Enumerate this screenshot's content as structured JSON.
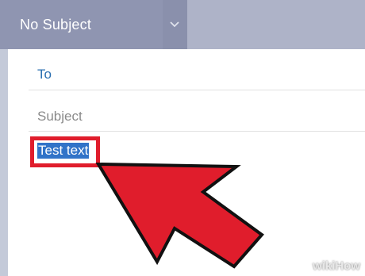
{
  "header": {
    "subject_title": "No Subject",
    "dropdown_icon": "chevron-down-icon"
  },
  "fields": {
    "to_label": "To",
    "subject_label": "Subject"
  },
  "body": {
    "text": "Test text"
  },
  "annotation": {
    "highlight_color": "#e01d2c",
    "arrow_color": "#e01d2c"
  },
  "watermark": {
    "text": "wikiHow"
  }
}
